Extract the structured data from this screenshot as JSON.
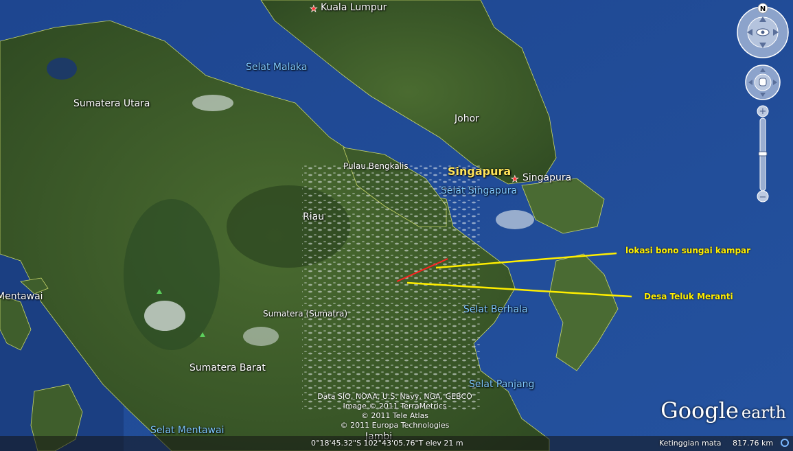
{
  "places": {
    "kuala_lumpur": "Kuala Lumpur",
    "selat_malaka": "Selat Malaka",
    "sumatera_utara": "Sumatera Utara",
    "johor": "Johor",
    "pulau_bengkalis": "Pulau Bengkalis",
    "singapura_region": "Singapura",
    "singapura_city": "Singapura",
    "selat_singapura": "Selat Singapura",
    "riau": "Riau",
    "mentawai": "Mentawai",
    "sumatera": "Sumatera (Sumatra)",
    "selat_berhala": "Selat Berhala",
    "sumatera_barat": "Sumatera Barat",
    "selat_panjang": "Selat Panjang",
    "selat_mentawai": "Selat Mentawai",
    "jambi": "Jambi"
  },
  "annotations": {
    "bono": "lokasi bono sungai kampar",
    "teluk": "Desa Teluk Meranti"
  },
  "credits": [
    "Data SIO, NOAA, U.S. Navy, NGA, GEBCO",
    "Image © 2011 TerraMetrics",
    "© 2011 Tele Atlas",
    "© 2011 Europa Technologies"
  ],
  "status": {
    "coords": "0°18'45.32\"S  102°43'05.76\"T  elev    21 m",
    "eye_label": "Ketinggian mata",
    "eye_value": "817.76 km"
  },
  "logo": {
    "google": "Google",
    "earth": "earth"
  },
  "compass": {
    "north": "N"
  },
  "zoom": {
    "plus": "+",
    "minus": "−"
  },
  "colors": {
    "sea": "#1f4f9a",
    "land": "#3d5a2a",
    "annotation": "#ffee00",
    "route": "#ff2020"
  }
}
